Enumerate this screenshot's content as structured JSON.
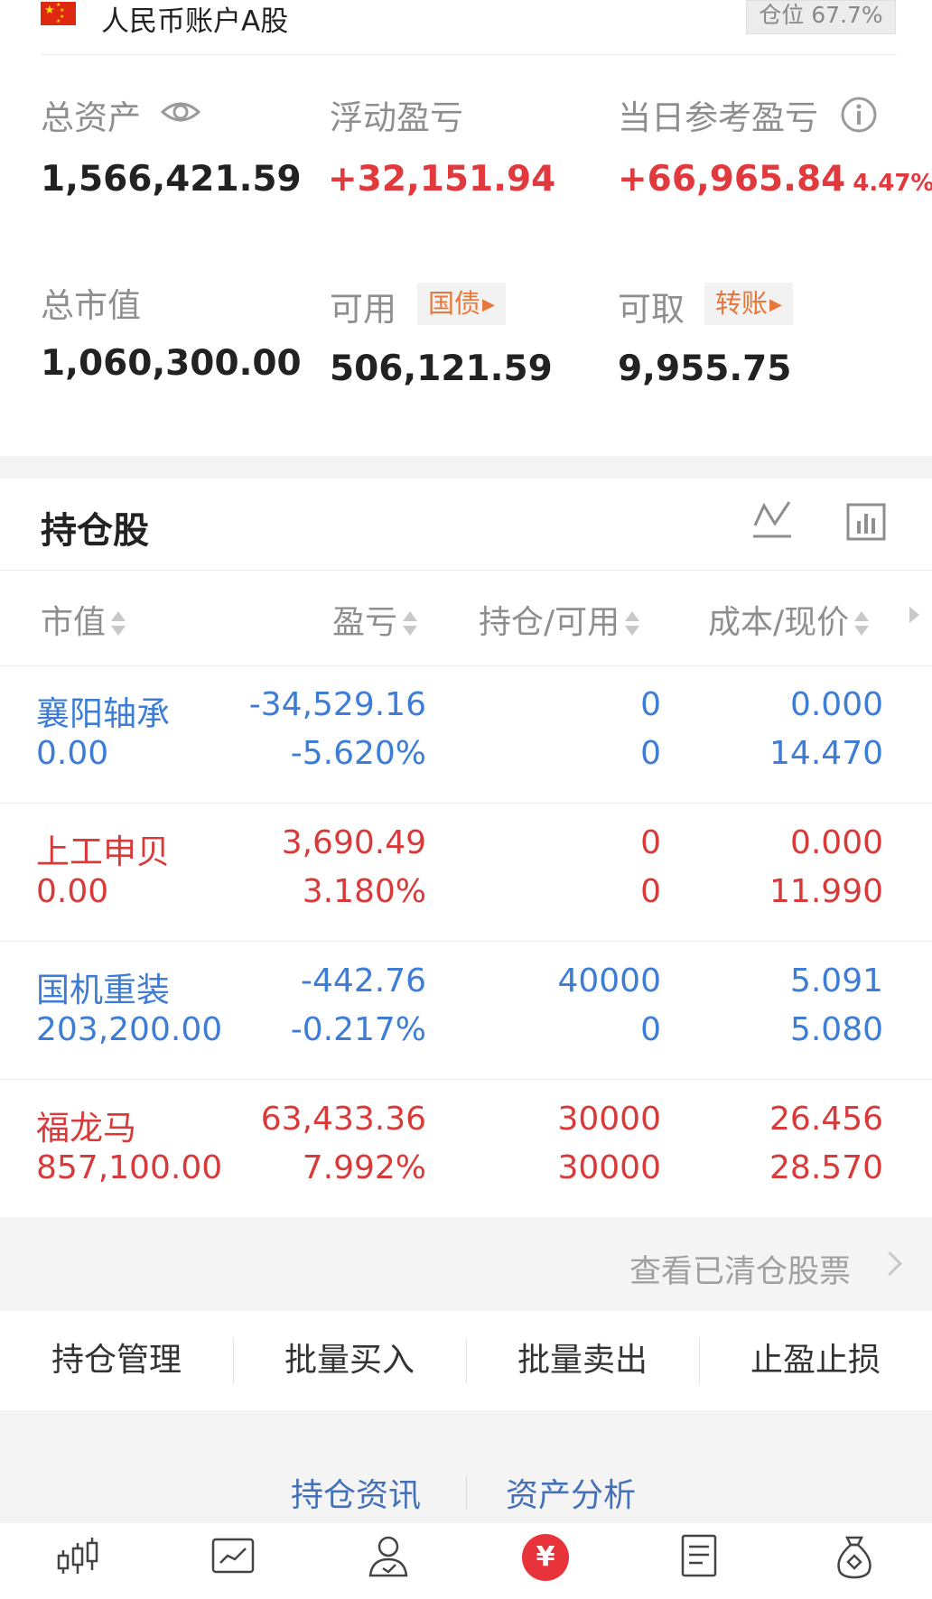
{
  "account": {
    "name": "人民币账户A股",
    "position_label": "仓位 67.7%",
    "position_fraction": 0.677
  },
  "summary": {
    "total_assets_label": "总资产",
    "total_assets_value": "1,566,421.59",
    "floating_pnl_label": "浮动盈亏",
    "floating_pnl_value": "+32,151.94",
    "daily_pnl_label": "当日参考盈亏",
    "daily_pnl_value": "+66,965.84",
    "daily_pnl_pct": "4.47%",
    "market_value_label": "总市值",
    "market_value_value": "1,060,300.00",
    "available_label": "可用",
    "available_value": "506,121.59",
    "treasury_btn": "国债",
    "withdrawable_label": "可取",
    "withdrawable_value": "9,955.75",
    "transfer_btn": "转账"
  },
  "holdings": {
    "title": "持仓股",
    "columns": [
      "市值",
      "盈亏",
      "持仓/可用",
      "成本/现价"
    ],
    "rows": [
      {
        "name": "襄阳轴承",
        "market_value": "0.00",
        "pnl": "-34,529.16",
        "pnl_pct": "-5.620%",
        "holding": "0",
        "available": "0",
        "cost": "0.000",
        "price": "14.470",
        "trend": "down"
      },
      {
        "name": "上工申贝",
        "market_value": "0.00",
        "pnl": "3,690.49",
        "pnl_pct": "3.180%",
        "holding": "0",
        "available": "0",
        "cost": "0.000",
        "price": "11.990",
        "trend": "up"
      },
      {
        "name": "国机重装",
        "market_value": "203,200.00",
        "pnl": "-442.76",
        "pnl_pct": "-0.217%",
        "holding": "40000",
        "available": "0",
        "cost": "5.091",
        "price": "5.080",
        "trend": "down"
      },
      {
        "name": "福龙马",
        "market_value": "857,100.00",
        "pnl": "63,433.36",
        "pnl_pct": "7.992%",
        "holding": "30000",
        "available": "30000",
        "cost": "26.456",
        "price": "28.570",
        "trend": "up"
      }
    ]
  },
  "cleared_link": "查看已清仓股票",
  "actions": [
    "持仓管理",
    "批量买入",
    "批量卖出",
    "止盈止损"
  ],
  "links": [
    "持仓资讯",
    "资产分析"
  ],
  "tabs": [
    {
      "icon": "candlestick-icon"
    },
    {
      "icon": "trend-chart-icon"
    },
    {
      "icon": "user-icon"
    },
    {
      "icon": "yuan-icon",
      "glyph": "¥",
      "active": true
    },
    {
      "icon": "document-icon"
    },
    {
      "icon": "money-bag-icon"
    }
  ],
  "colors": {
    "up": "#d83a3a",
    "down": "#3d7dd6",
    "accent_orange": "#e8773b",
    "link_blue": "#4470b8"
  }
}
